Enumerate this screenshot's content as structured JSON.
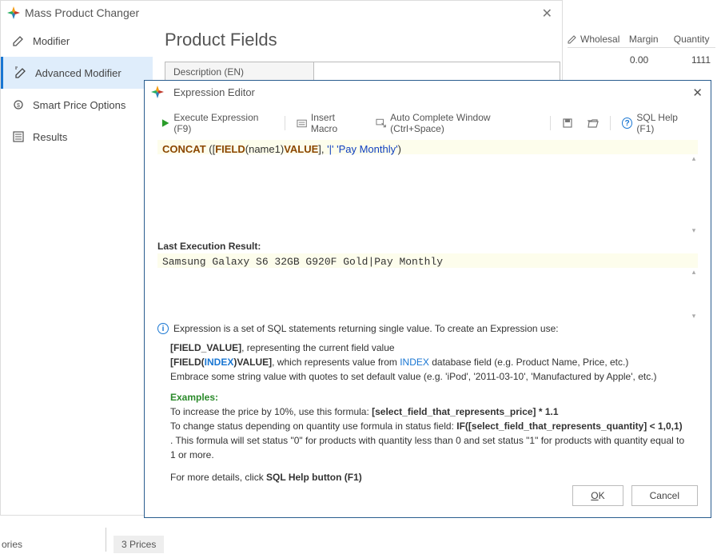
{
  "mainWindow": {
    "title": "Mass Product Changer",
    "sidebar": {
      "modifier": "Modifier",
      "advanced": "Advanced Modifier",
      "smartprice": "Smart Price Options",
      "results": "Results"
    },
    "content": {
      "pageTitle": "Product Fields",
      "fieldLabel": "Description (EN)"
    }
  },
  "rightPanel": {
    "col1": "Wholesal",
    "col2": "Margin",
    "col3": "Quantity",
    "val2": "0.00",
    "val3": "1111"
  },
  "expr": {
    "title": "Expression Editor",
    "toolbar": {
      "execute": "Execute Expression (F9)",
      "macro": "Insert Macro",
      "auto": "Auto Complete Window (Ctrl+Space)",
      "sqlhelp": "SQL Help (F1)"
    },
    "code": {
      "p1": "CONCAT",
      "p2": " ([",
      "p3": "FIELD",
      "p4": "(name1)",
      "p5": "VALUE",
      "p6": "], ",
      "p7": "'|'",
      "p8": " ",
      "p9": "'Pay Monthly'",
      "p10": ")"
    },
    "lastResultLabel": "Last Execution Result:",
    "result": "Samsung Galaxy S6 32GB G920F Gold|Pay Monthly",
    "infoText": "Expression is a set of SQL statements returning single value. To create an Expression use:",
    "help": {
      "l1a": "[FIELD_VALUE]",
      "l1b": ", representing the current field value",
      "l2a": "[FIELD(",
      "l2b": "INDEX",
      "l2c": ")VALUE]",
      "l2d": ", which represents value from ",
      "l2e": "INDEX",
      "l2f": " database field (e.g. Product Name, Price, etc.)",
      "l3": "Embrace some string value with quotes to set default value (e.g. 'iPod', '2011-03-10', 'Manufactured by Apple', etc.)",
      "ex": "Examples:",
      "e1a": "   To increase the price by 10%, use this formula: ",
      "e1b": "[select_field_that_represents_price] * 1.1",
      "e2a": "   To change status depending on quantity use formula in status field: ",
      "e2b": "IF([select_field_that_represents_quantity] < 1,0,1)",
      "e2c": " . This formula will set status \"0\" for products with quantity less than 0 and set status \"1\" for products with quantity equal to 1 or more.",
      "more1": "For more details, click ",
      "more2": "SQL Help button (F1)"
    },
    "buttons": {
      "ok": "OK",
      "cancel": "Cancel",
      "okU": "O",
      "okR": "K"
    }
  },
  "bottom": {
    "left": "ories",
    "tab": "3 Prices"
  }
}
